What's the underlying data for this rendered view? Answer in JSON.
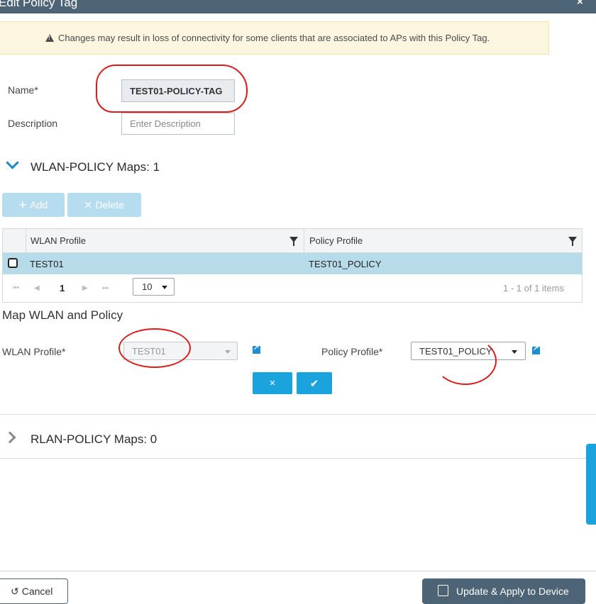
{
  "dialog": {
    "title": "Edit Policy Tag",
    "close_label": "×"
  },
  "warning": {
    "text": "Changes may result in loss of connectivity for some clients that are associated to APs with this Policy Tag."
  },
  "form": {
    "name_label": "Name*",
    "name_value": "TEST01-POLICY-TAG",
    "description_label": "Description",
    "description_placeholder": "Enter Description"
  },
  "wlan_section": {
    "title": "WLAN-POLICY Maps: 1",
    "add_label": "Add",
    "delete_label": "Delete",
    "columns": [
      "WLAN Profile",
      "Policy Profile"
    ],
    "rows": [
      {
        "wlan": "TEST01",
        "policy": "TEST01_POLICY"
      }
    ],
    "pager": {
      "page": "1",
      "page_size": "10",
      "info": "1 - 1 of 1 items"
    }
  },
  "map_section": {
    "title": "Map WLAN and Policy",
    "wlan_label": "WLAN Profile*",
    "wlan_value": "TEST01",
    "policy_label": "Policy Profile*",
    "policy_value": "TEST01_POLICY",
    "cancel_icon": "×",
    "confirm_icon": "✔"
  },
  "rlan_section": {
    "title": "RLAN-POLICY Maps: 0"
  },
  "footer": {
    "cancel_label": "Cancel",
    "update_label": "Update & Apply to Device"
  },
  "colors": {
    "header": "#4d6476",
    "accent": "#1aa3dc",
    "row_selected": "#b8dbe9",
    "annotation": "#d91c1c"
  }
}
